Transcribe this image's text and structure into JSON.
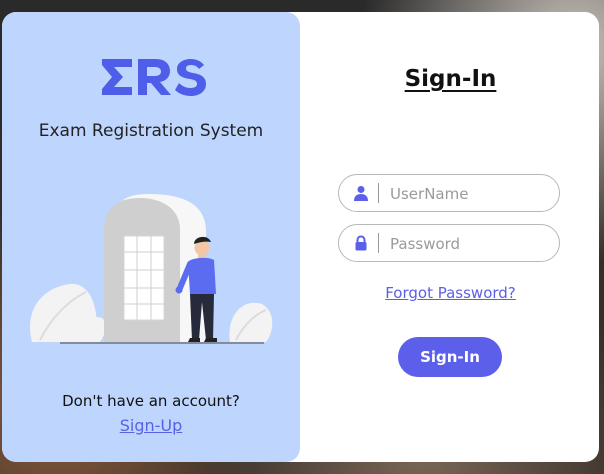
{
  "brand": {
    "logo_text": "ERS",
    "tagline": "Exam Registration System"
  },
  "left_panel": {
    "no_account_text": "Don't have an account?",
    "signup_link": "Sign-Up"
  },
  "form": {
    "title": "Sign-In",
    "username_placeholder": "UserName",
    "password_placeholder": "Password",
    "forgot_link": "Forgot Password?",
    "submit_label": "Sign-In"
  },
  "colors": {
    "accent": "#5b5fea",
    "panel_bg": "#bed5fd",
    "card_bg": "#ffffff"
  },
  "icons": {
    "username": "user-icon",
    "password": "lock-icon"
  }
}
